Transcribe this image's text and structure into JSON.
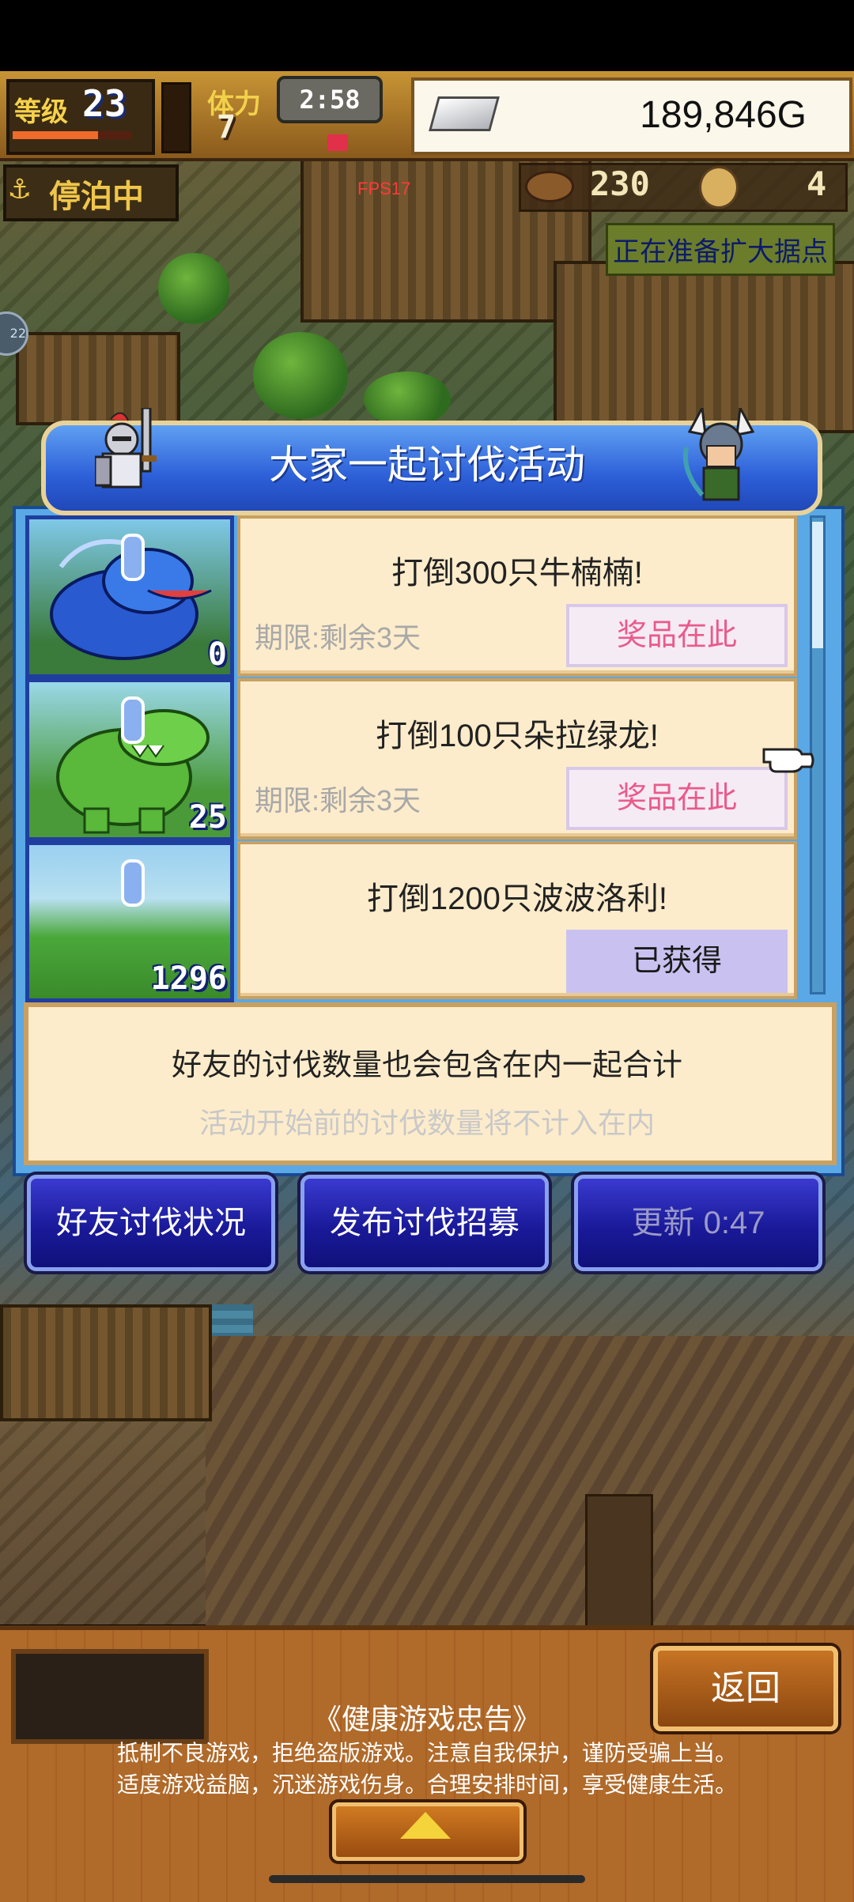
{
  "hud": {
    "level_label": "等级",
    "level_value": "23",
    "xp_fraction": 0.72,
    "hp_fraction": 0.25,
    "stamina_label": "体力",
    "stamina_value": "7",
    "timer": "2:58",
    "gold": "189,846G",
    "status_label": "停泊中",
    "fps": "FPS17",
    "resource_a": "230",
    "resource_b": "4",
    "expand_notice": "正在准备扩大据点",
    "side_badge": "22",
    "icons": {
      "currency": "silver-ingot-icon",
      "anchor": "anchor-icon",
      "fish": "fish-icon",
      "coin": "coin-icon"
    }
  },
  "dialog": {
    "title": "大家一起讨伐活动",
    "quests": [
      {
        "title": "打倒300只牛楠楠!",
        "deadline": "期限:剩余3天",
        "button": "奖品在此",
        "count": "0",
        "claimed": false
      },
      {
        "title": "打倒100只朵拉绿龙!",
        "deadline": "期限:剩余3天",
        "button": "奖品在此",
        "count": "25",
        "claimed": false
      },
      {
        "title": "打倒1200只波波洛利!",
        "deadline": "",
        "button": "已获得",
        "count": "1296",
        "claimed": true
      }
    ],
    "info_line1": "好友的讨伐数量也会包含在内一起合计",
    "info_line2": "活动开始前的讨伐数量将不计入在内",
    "buttons": {
      "friends": "好友讨伐状况",
      "recruit": "发布讨伐招募",
      "refresh": "更新 0:47"
    }
  },
  "bottom": {
    "back": "返回",
    "health_title": "《健康游戏忠告》",
    "health_line1": "抵制不良游戏，拒绝盗版游戏。注意自我保护，谨防受骗上当。",
    "health_line2": "适度游戏益脑，沉迷游戏伤身。合理安排时间，享受健康生活。"
  },
  "colors": {
    "dialog_blue": "#2d5fd8",
    "prize_pink": "#ea5a8a",
    "claimed_lavender": "#c9c2f0",
    "card_cream": "#fdeccb"
  }
}
